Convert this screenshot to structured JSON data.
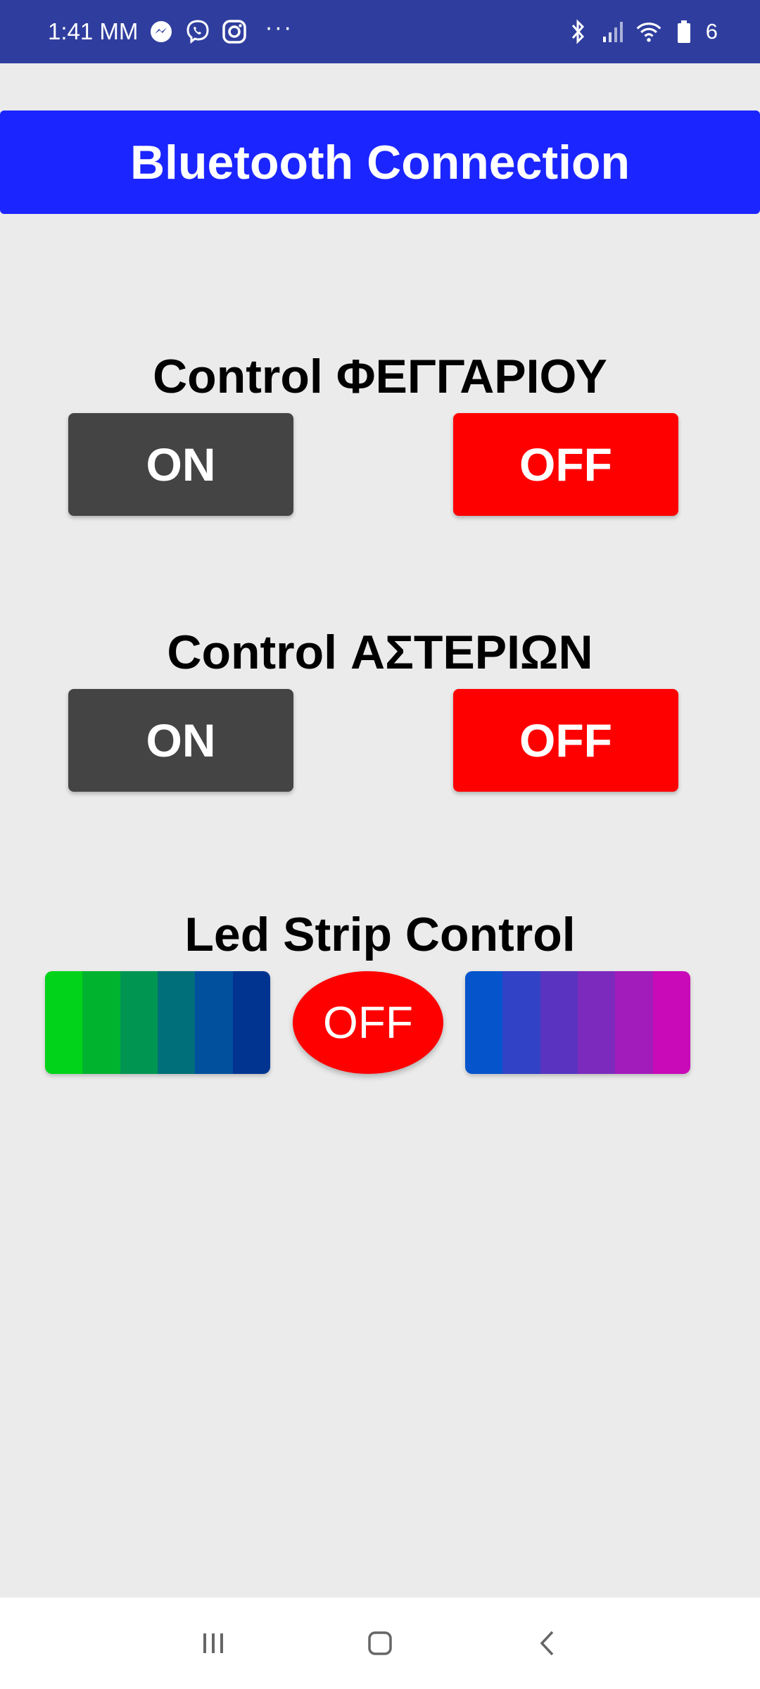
{
  "status_bar": {
    "time": "1:41 MM",
    "battery_level": "6",
    "icons_left": [
      "messenger-icon",
      "viber-icon",
      "instagram-icon"
    ],
    "more_indicator": "···",
    "icons_right": [
      "bluetooth-icon",
      "signal-icon",
      "wifi-icon",
      "battery-icon"
    ],
    "background_color": "#2f3e9e"
  },
  "header": {
    "title": "Bluetooth Connection",
    "background_color": "#1b25ff"
  },
  "sections": [
    {
      "heading": "Control ΦΕΓΓΑΡΙΟΥ",
      "on_label": "ON",
      "off_label": "OFF"
    },
    {
      "heading": "Control ΑΣΤΕΡΙΩΝ",
      "on_label": "ON",
      "off_label": "OFF"
    }
  ],
  "led_strip": {
    "heading": "Led Strip Control",
    "off_label": "OFF",
    "left_gradient_colors": [
      "#00d31a",
      "#00b32f",
      "#009652",
      "#006f7a",
      "#00509e",
      "#003490"
    ],
    "right_gradient_colors": [
      "#0554cc",
      "#3142c6",
      "#5a34c0",
      "#7c2abd",
      "#a21cbb",
      "#c80ab8"
    ]
  },
  "colors": {
    "on_button": "#444444",
    "off_button": "#ff0000",
    "page_background": "#ebebeb"
  },
  "nav_bar": {
    "items": [
      "recent-apps-icon",
      "home-icon",
      "back-icon"
    ]
  }
}
